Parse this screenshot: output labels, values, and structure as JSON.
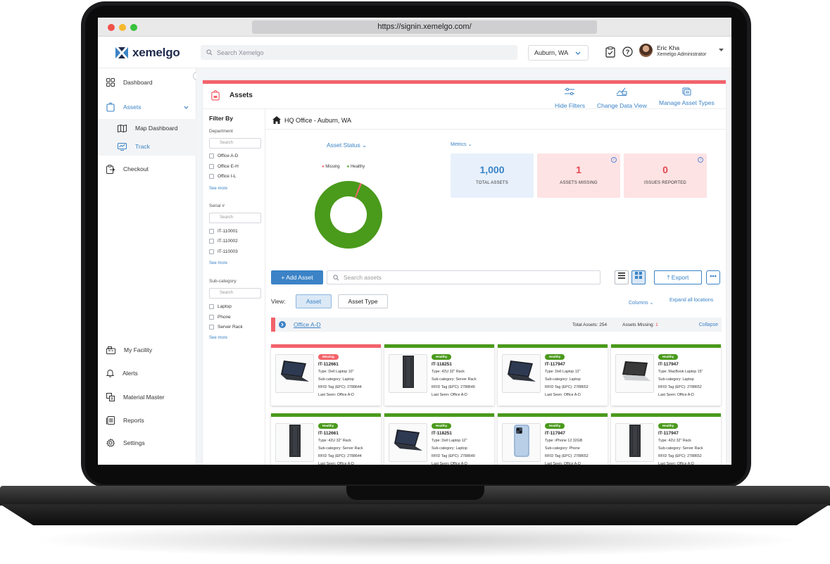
{
  "browser": {
    "url": "https://signin.xemelgo.com/"
  },
  "topbar": {
    "logo_text": "xemelgo",
    "search_placeholder": "Search Xemelgo",
    "location": "Auburn, WA",
    "user_name": "Eric Kha",
    "user_role": "Xemelgo Administrator"
  },
  "sidebar": {
    "items": [
      {
        "label": "Dashboard",
        "icon": "dashboard-icon"
      },
      {
        "label": "Assets",
        "icon": "tag-icon"
      },
      {
        "label": "Map Dashboard",
        "icon": "map-icon"
      },
      {
        "label": "Track",
        "icon": "track-icon"
      },
      {
        "label": "Checkout",
        "icon": "checkout-icon"
      },
      {
        "label": "My Facility",
        "icon": "facility-icon"
      },
      {
        "label": "Alerts",
        "icon": "bell-icon"
      },
      {
        "label": "Material Master",
        "icon": "material-icon"
      },
      {
        "label": "Reports",
        "icon": "reports-icon"
      },
      {
        "label": "Settings",
        "icon": "gear-icon"
      }
    ]
  },
  "panel": {
    "title": "Assets",
    "actions": [
      "Hide Filters",
      "Change Data View",
      "Manage Asset Types"
    ]
  },
  "filters": {
    "title": "Filter By",
    "search_placeholder": "Search",
    "see_more": "See more",
    "sections": [
      {
        "label": "Department",
        "options": [
          "Office A-D",
          "Office E-H",
          "Office I-L"
        ]
      },
      {
        "label": "Serial #",
        "options": [
          "IT-110001",
          "IT-110002",
          "IT-110003"
        ]
      },
      {
        "label": "Sub-category",
        "options": [
          "Laptop",
          "Phone",
          "Server Rack"
        ]
      }
    ]
  },
  "content": {
    "location_title": "HQ Office - Auburn, WA",
    "status_dropdown": "Asset Status",
    "metrics_dropdown": "Metrics",
    "legend": [
      "Missing",
      "Healthy"
    ],
    "metrics": [
      {
        "value": "1,000",
        "label": "TOTAL ASSETS"
      },
      {
        "value": "1",
        "label": "ASSETS MISSING"
      },
      {
        "value": "0",
        "label": "ISSUES REPORTED"
      }
    ],
    "add_button": "+ Add Asset",
    "search_placeholder": "Search assets",
    "export_label": "Export",
    "more_label": "•••",
    "view_label": "View:",
    "view_options": [
      "Asset",
      "Asset Type"
    ],
    "columns_label": "Columns",
    "expand_label": "Expand all locations",
    "group": {
      "name": "Office A-D",
      "total_label": "Total Assets:",
      "total_value": "254",
      "missing_label": "Assets Missing:",
      "missing_value": "1",
      "collapse_label": "Collapse"
    }
  },
  "chart_data": {
    "type": "pie",
    "categories": [
      "Missing",
      "Healthy"
    ],
    "values": [
      1,
      999
    ],
    "colors": [
      "#f2636a",
      "#4a9a1c"
    ]
  },
  "cards": [
    {
      "status": "Missing",
      "id": "IT-112661",
      "type": "Type: Dell Laptop 10\"",
      "sub": "Sub-category: Laptop",
      "rfid": "RFID Tag (EPC): 2788644",
      "seen": "Last Seen: Office A-D",
      "image": "laptop"
    },
    {
      "status": "Healthy",
      "id": "IT-118251",
      "type": "Type: 42U 32\" Rack",
      "sub": "Sub-category: Server Rack",
      "rfid": "RFID Tag (EPC): 2788649",
      "seen": "Last Seen: Office A-D",
      "image": "rack"
    },
    {
      "status": "Healthy",
      "id": "IT-117947",
      "type": "Type: Dell Laptop 12\"",
      "sub": "Sub-category: Laptop",
      "rfid": "RFID Tag (EPC): 2788652",
      "seen": "Last Seen: Office A-D",
      "image": "laptop"
    },
    {
      "status": "Healthy",
      "id": "IT-117947",
      "type": "Type: MacBook Laptop 15\"",
      "sub": "Sub-category: Laptop",
      "rfid": "RFID Tag (EPC): 2788652",
      "seen": "Last Seen: Office A-D",
      "image": "macbook"
    },
    {
      "status": "Healthy",
      "id": "IT-112661",
      "type": "Type: 42U 32\" Rack",
      "sub": "Sub-category: Server Rack",
      "rfid": "RFID Tag (EPC): 2788644",
      "seen": "Last Seen: Office A-D",
      "image": "rack"
    },
    {
      "status": "Healthy",
      "id": "IT-118251",
      "type": "Type: Dell Laptop 12\"",
      "sub": "Sub-category: Laptop",
      "rfid": "RFID Tag (EPC): 2788649",
      "seen": "Last Seen: Office A-D",
      "image": "laptop"
    },
    {
      "status": "Healthy",
      "id": "IT-117947",
      "type": "Type: iPhone 12 32GB",
      "sub": "Sub-category: Phone",
      "rfid": "RFID Tag (EPC): 2788652",
      "seen": "Last Seen: Office A-D",
      "image": "phone"
    },
    {
      "status": "Healthy",
      "id": "IT-117947",
      "type": "Type: 42U 32\" Rack",
      "sub": "Sub-category: Server Rack",
      "rfid": "RFID Tag (EPC): 2788652",
      "seen": "Last Seen: Office A-D",
      "image": "rack"
    }
  ],
  "colors": {
    "accent": "#3b83c6",
    "missing": "#f2636a",
    "healthy": "#4a9a1c",
    "navy": "#1f2b4d"
  }
}
